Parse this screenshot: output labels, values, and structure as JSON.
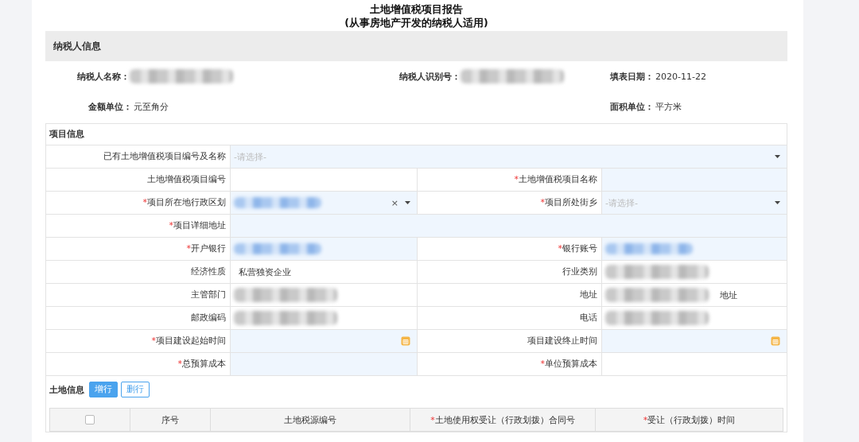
{
  "title": "土地增值税项目报告",
  "subtitle": "(从事房地产开发的纳税人适用)",
  "taxpayer": {
    "heading": "纳税人信息",
    "rows": [
      [
        {
          "label": "纳税人名称：",
          "redacted": true
        },
        {
          "label": "纳税人识别号：",
          "redacted": true
        },
        {
          "label": "填表日期：",
          "value": "2020-11-22"
        }
      ],
      [
        {
          "label": "金额单位：",
          "value": "元至角分"
        },
        null,
        {
          "label": "面积单位：",
          "value": "平方米"
        }
      ]
    ]
  },
  "project": {
    "heading": "项目信息",
    "rows": [
      [
        {
          "label": "已有土地增值税项目编号及名称",
          "kind": "select",
          "editable": true,
          "placeholder": "-请选择-",
          "full": true
        }
      ],
      [
        {
          "label": "土地增值税项目编号",
          "kind": "text",
          "editable": false
        },
        {
          "label": "土地增值税项目名称",
          "required_mark": "*",
          "kind": "text",
          "editable": true
        }
      ],
      [
        {
          "label": "项目所在地行政区划",
          "required_mark": "*",
          "kind": "select_clear",
          "editable": true,
          "redacted": true,
          "clear": "×"
        },
        {
          "label": "项目所处街乡",
          "required_mark": "*",
          "kind": "select",
          "editable": true,
          "placeholder": "-请选择-"
        }
      ],
      [
        {
          "label": "项目详细地址",
          "required_mark": "*",
          "kind": "text",
          "editable": true,
          "full": true
        }
      ],
      [
        {
          "label": "开户银行",
          "required_mark": "*",
          "kind": "text",
          "editable": true,
          "redacted": true
        },
        {
          "label": "银行账号",
          "required_mark": "*",
          "kind": "text",
          "editable": true,
          "redacted": true
        }
      ],
      [
        {
          "label": "经济性质",
          "kind": "text",
          "editable": false,
          "value": "私营独资企业"
        },
        {
          "label": "行业类别",
          "kind": "text",
          "editable": false,
          "redacted": true
        }
      ],
      [
        {
          "label": "主管部门",
          "kind": "text",
          "editable": false,
          "redacted": true
        },
        {
          "label": "地址",
          "kind": "text",
          "editable": false,
          "redacted": true,
          "value": "地址"
        }
      ],
      [
        {
          "label": "邮政编码",
          "kind": "text",
          "editable": false,
          "redacted": true
        },
        {
          "label": "电话",
          "kind": "text",
          "editable": false,
          "redacted": true
        }
      ],
      [
        {
          "label": "项目建设起始时间",
          "required_mark": "*",
          "kind": "date",
          "editable": true
        },
        {
          "label": "项目建设终止时间",
          "kind": "date",
          "editable": true
        }
      ],
      [
        {
          "label": "总预算成本",
          "required_mark": "*",
          "kind": "text",
          "editable": true
        },
        {
          "label": "单位预算成本",
          "required_mark": "*",
          "kind": "text",
          "editable": false
        }
      ]
    ]
  },
  "land": {
    "heading": "土地信息",
    "buttons": [
      {
        "label": "增行",
        "kind": "primary"
      },
      {
        "label": "删行",
        "kind": "outline"
      }
    ],
    "columns": [
      {
        "kind": "checkbox",
        "checked": false
      },
      {
        "label": "序号"
      },
      {
        "label": "土地税源编号"
      },
      {
        "label": "土地使用权受让（行政划拨）合同号",
        "required_mark": "*"
      },
      {
        "label": "受让（行政划拨）时间",
        "required_mark": "*"
      }
    ]
  }
}
